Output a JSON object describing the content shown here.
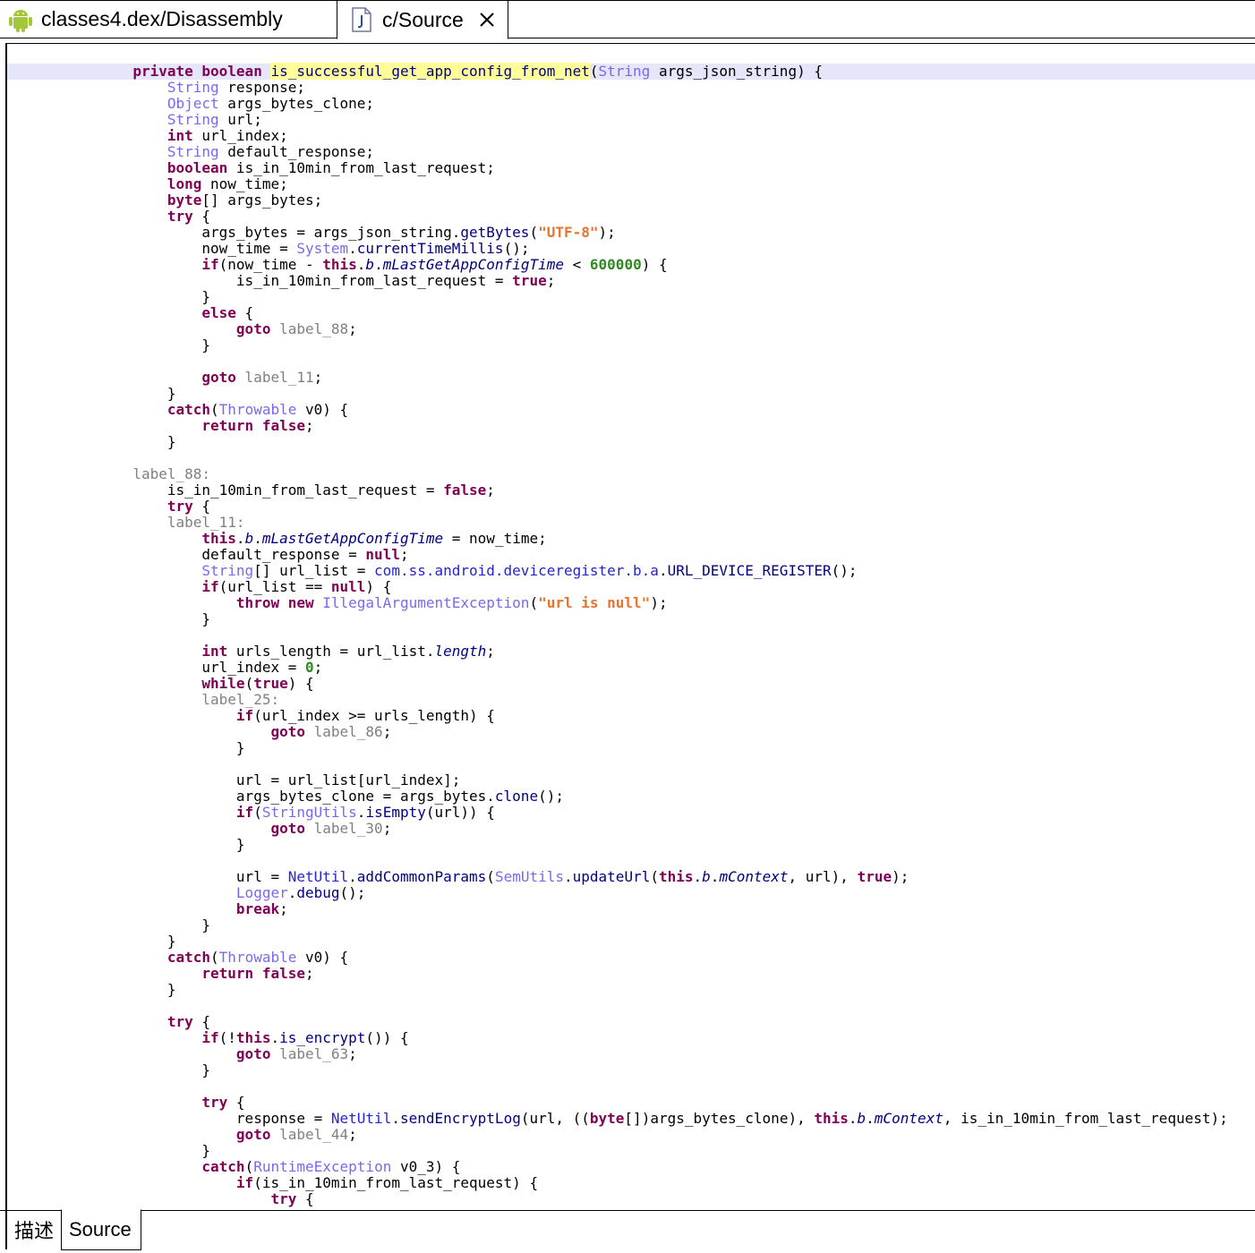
{
  "tabs": [
    {
      "label": "classes4.dex/Disassembly",
      "icon": "android-icon"
    },
    {
      "label": "c/Source",
      "icon": "java-file-icon",
      "closable": true
    }
  ],
  "bottom_tabs": [
    {
      "label": "描述"
    },
    {
      "label": "Source"
    }
  ],
  "colors": {
    "keyword": "#7f0055",
    "type": "#7b68ee",
    "string": "#e9732b",
    "number": "#2f8a21",
    "label": "#808080",
    "highlight_line": "#e6e6fa",
    "method_highlight": "#ffff99"
  },
  "code_lines": [
    [
      [
        "kw",
        "private "
      ],
      [
        "kw",
        "boolean "
      ],
      [
        "mh",
        "is_successful_get_app_config_from_net"
      ],
      [
        "",
        "("
      ],
      [
        "ty",
        "String"
      ],
      [
        "",
        " args_json_string) {"
      ]
    ],
    [
      [
        "",
        "    "
      ],
      [
        "ty",
        "String"
      ],
      [
        "",
        " response;"
      ]
    ],
    [
      [
        "",
        "    "
      ],
      [
        "ty",
        "Object"
      ],
      [
        "",
        " args_bytes_clone;"
      ]
    ],
    [
      [
        "",
        "    "
      ],
      [
        "ty",
        "String"
      ],
      [
        "",
        " url;"
      ]
    ],
    [
      [
        "",
        "    "
      ],
      [
        "kw",
        "int"
      ],
      [
        "",
        " url_index;"
      ]
    ],
    [
      [
        "",
        "    "
      ],
      [
        "ty",
        "String"
      ],
      [
        "",
        " default_response;"
      ]
    ],
    [
      [
        "",
        "    "
      ],
      [
        "kw",
        "boolean"
      ],
      [
        "",
        " is_in_10min_from_last_request;"
      ]
    ],
    [
      [
        "",
        "    "
      ],
      [
        "kw",
        "long"
      ],
      [
        "",
        " now_time;"
      ]
    ],
    [
      [
        "",
        "    "
      ],
      [
        "kw",
        "byte"
      ],
      [
        "",
        "[] args_bytes;"
      ]
    ],
    [
      [
        "",
        "    "
      ],
      [
        "kw",
        "try"
      ],
      [
        "",
        " {"
      ]
    ],
    [
      [
        "",
        "        args_bytes = args_json_string."
      ],
      [
        "fn",
        "getBytes"
      ],
      [
        "",
        "("
      ],
      [
        "st",
        "\"UTF-8\""
      ],
      [
        "",
        ");"
      ]
    ],
    [
      [
        "",
        "        now_time = "
      ],
      [
        "ty",
        "System"
      ],
      [
        "",
        "."
      ],
      [
        "fn",
        "currentTimeMillis"
      ],
      [
        "",
        "();"
      ]
    ],
    [
      [
        "",
        "        "
      ],
      [
        "kw",
        "if"
      ],
      [
        "",
        "(now_time - "
      ],
      [
        "kw",
        "this"
      ],
      [
        "",
        "."
      ],
      [
        "fi",
        "b"
      ],
      [
        "",
        "."
      ],
      [
        "fi",
        "mLastGetAppConfigTime"
      ],
      [
        "",
        " < "
      ],
      [
        "nm",
        "600000"
      ],
      [
        "",
        ") {"
      ]
    ],
    [
      [
        "",
        "            is_in_10min_from_last_request = "
      ],
      [
        "kw",
        "true"
      ],
      [
        "",
        ";"
      ]
    ],
    [
      [
        "",
        "        }"
      ]
    ],
    [
      [
        "",
        "        "
      ],
      [
        "kw",
        "else"
      ],
      [
        "",
        " {"
      ]
    ],
    [
      [
        "",
        "            "
      ],
      [
        "kw",
        "goto"
      ],
      [
        "lb",
        " label_88"
      ],
      [
        "",
        ";"
      ]
    ],
    [
      [
        "",
        "        }"
      ]
    ],
    [
      [
        "",
        ""
      ]
    ],
    [
      [
        "",
        "        "
      ],
      [
        "kw",
        "goto"
      ],
      [
        "lb",
        " label_11"
      ],
      [
        "",
        ";"
      ]
    ],
    [
      [
        "",
        "    }"
      ]
    ],
    [
      [
        "",
        "    "
      ],
      [
        "kw",
        "catch"
      ],
      [
        "",
        "("
      ],
      [
        "ty",
        "Throwable"
      ],
      [
        "",
        " v0) {"
      ]
    ],
    [
      [
        "",
        "        "
      ],
      [
        "kw",
        "return "
      ],
      [
        "kw",
        "false"
      ],
      [
        "",
        ";"
      ]
    ],
    [
      [
        "",
        "    }"
      ]
    ],
    [
      [
        "",
        ""
      ]
    ],
    [
      [
        "lb",
        "label_88:"
      ]
    ],
    [
      [
        "",
        "    is_in_10min_from_last_request = "
      ],
      [
        "kw",
        "false"
      ],
      [
        "",
        ";"
      ]
    ],
    [
      [
        "",
        "    "
      ],
      [
        "kw",
        "try"
      ],
      [
        "",
        " {"
      ]
    ],
    [
      [
        "lb",
        "    label_11:"
      ]
    ],
    [
      [
        "",
        "        "
      ],
      [
        "kw",
        "this"
      ],
      [
        "",
        "."
      ],
      [
        "fi",
        "b"
      ],
      [
        "",
        "."
      ],
      [
        "fi",
        "mLastGetAppConfigTime"
      ],
      [
        "",
        " = now_time;"
      ]
    ],
    [
      [
        "",
        "        default_response = "
      ],
      [
        "kw",
        "null"
      ],
      [
        "",
        ";"
      ]
    ],
    [
      [
        "",
        "        "
      ],
      [
        "ty",
        "String"
      ],
      [
        "",
        "[] url_list = "
      ],
      [
        "cls",
        "com.ss.android.deviceregister.b.a"
      ],
      [
        "",
        "."
      ],
      [
        "fn",
        "URL_DEVICE_REGISTER"
      ],
      [
        "",
        "();"
      ]
    ],
    [
      [
        "",
        "        "
      ],
      [
        "kw",
        "if"
      ],
      [
        "",
        "(url_list == "
      ],
      [
        "kw",
        "null"
      ],
      [
        "",
        ") {"
      ]
    ],
    [
      [
        "",
        "            "
      ],
      [
        "kw",
        "throw "
      ],
      [
        "kw",
        "new "
      ],
      [
        "ty",
        "IllegalArgumentException"
      ],
      [
        "",
        "("
      ],
      [
        "st",
        "\"url is null\""
      ],
      [
        "",
        ");"
      ]
    ],
    [
      [
        "",
        "        }"
      ]
    ],
    [
      [
        "",
        ""
      ]
    ],
    [
      [
        "",
        "        "
      ],
      [
        "kw",
        "int"
      ],
      [
        "",
        " urls_length = url_list."
      ],
      [
        "fi",
        "length"
      ],
      [
        "",
        ";"
      ]
    ],
    [
      [
        "",
        "        url_index = "
      ],
      [
        "nm",
        "0"
      ],
      [
        "",
        ";"
      ]
    ],
    [
      [
        "",
        "        "
      ],
      [
        "kw",
        "while"
      ],
      [
        "",
        "("
      ],
      [
        "kw",
        "true"
      ],
      [
        "",
        ") {"
      ]
    ],
    [
      [
        "lb",
        "        label_25:"
      ]
    ],
    [
      [
        "",
        "            "
      ],
      [
        "kw",
        "if"
      ],
      [
        "",
        "(url_index >= urls_length) {"
      ]
    ],
    [
      [
        "",
        "                "
      ],
      [
        "kw",
        "goto"
      ],
      [
        "lb",
        " label_86"
      ],
      [
        "",
        ";"
      ]
    ],
    [
      [
        "",
        "            }"
      ]
    ],
    [
      [
        "",
        ""
      ]
    ],
    [
      [
        "",
        "            url = url_list[url_index];"
      ]
    ],
    [
      [
        "",
        "            args_bytes_clone = args_bytes."
      ],
      [
        "fn",
        "clone"
      ],
      [
        "",
        "();"
      ]
    ],
    [
      [
        "",
        "            "
      ],
      [
        "kw",
        "if"
      ],
      [
        "",
        "("
      ],
      [
        "ty",
        "StringUtils"
      ],
      [
        "",
        "."
      ],
      [
        "fn",
        "isEmpty"
      ],
      [
        "",
        "(url)) {"
      ]
    ],
    [
      [
        "",
        "                "
      ],
      [
        "kw",
        "goto"
      ],
      [
        "lb",
        " label_30"
      ],
      [
        "",
        ";"
      ]
    ],
    [
      [
        "",
        "            }"
      ]
    ],
    [
      [
        "",
        ""
      ]
    ],
    [
      [
        "",
        "            url = "
      ],
      [
        "cls",
        "NetUtil"
      ],
      [
        "",
        "."
      ],
      [
        "fn",
        "addCommonParams"
      ],
      [
        "",
        "("
      ],
      [
        "ty",
        "SemUtils"
      ],
      [
        "",
        "."
      ],
      [
        "fn",
        "updateUrl"
      ],
      [
        "",
        "("
      ],
      [
        "kw",
        "this"
      ],
      [
        "",
        "."
      ],
      [
        "fi",
        "b"
      ],
      [
        "",
        "."
      ],
      [
        "fi",
        "mContext"
      ],
      [
        "",
        ", url), "
      ],
      [
        "kw",
        "true"
      ],
      [
        "",
        ");"
      ]
    ],
    [
      [
        "",
        "            "
      ],
      [
        "ty",
        "Logger"
      ],
      [
        "",
        "."
      ],
      [
        "fn",
        "debug"
      ],
      [
        "",
        "();"
      ]
    ],
    [
      [
        "",
        "            "
      ],
      [
        "kw",
        "break"
      ],
      [
        "",
        ";"
      ]
    ],
    [
      [
        "",
        "        }"
      ]
    ],
    [
      [
        "",
        "    }"
      ]
    ],
    [
      [
        "",
        "    "
      ],
      [
        "kw",
        "catch"
      ],
      [
        "",
        "("
      ],
      [
        "ty",
        "Throwable"
      ],
      [
        "",
        " v0) {"
      ]
    ],
    [
      [
        "",
        "        "
      ],
      [
        "kw",
        "return "
      ],
      [
        "kw",
        "false"
      ],
      [
        "",
        ";"
      ]
    ],
    [
      [
        "",
        "    }"
      ]
    ],
    [
      [
        "",
        ""
      ]
    ],
    [
      [
        "",
        "    "
      ],
      [
        "kw",
        "try"
      ],
      [
        "",
        " {"
      ]
    ],
    [
      [
        "",
        "        "
      ],
      [
        "kw",
        "if"
      ],
      [
        "",
        "(!"
      ],
      [
        "kw",
        "this"
      ],
      [
        "",
        "."
      ],
      [
        "fn",
        "is_encrypt"
      ],
      [
        "",
        "()) {"
      ]
    ],
    [
      [
        "",
        "            "
      ],
      [
        "kw",
        "goto"
      ],
      [
        "lb",
        " label_63"
      ],
      [
        "",
        ";"
      ]
    ],
    [
      [
        "",
        "        }"
      ]
    ],
    [
      [
        "",
        ""
      ]
    ],
    [
      [
        "",
        "        "
      ],
      [
        "kw",
        "try"
      ],
      [
        "",
        " {"
      ]
    ],
    [
      [
        "",
        "            response = "
      ],
      [
        "cls",
        "NetUtil"
      ],
      [
        "",
        "."
      ],
      [
        "fn",
        "sendEncryptLog"
      ],
      [
        "",
        "(url, (("
      ],
      [
        "kw",
        "byte"
      ],
      [
        "",
        "[])args_bytes_clone), "
      ],
      [
        "kw",
        "this"
      ],
      [
        "",
        "."
      ],
      [
        "fi",
        "b"
      ],
      [
        "",
        "."
      ],
      [
        "fi",
        "mContext"
      ],
      [
        "",
        ", is_in_10min_from_last_request);"
      ]
    ],
    [
      [
        "",
        "            "
      ],
      [
        "kw",
        "goto"
      ],
      [
        "lb",
        " label_44"
      ],
      [
        "",
        ";"
      ]
    ],
    [
      [
        "",
        "        }"
      ]
    ],
    [
      [
        "",
        "        "
      ],
      [
        "kw",
        "catch"
      ],
      [
        "",
        "("
      ],
      [
        "ty",
        "RuntimeException"
      ],
      [
        "",
        " v0_3) {"
      ]
    ],
    [
      [
        "",
        "            "
      ],
      [
        "kw",
        "if"
      ],
      [
        "",
        "(is_in_10min_from_last_request) {"
      ]
    ],
    [
      [
        "",
        "                "
      ],
      [
        "kw",
        "try"
      ],
      [
        "",
        " {"
      ]
    ]
  ]
}
